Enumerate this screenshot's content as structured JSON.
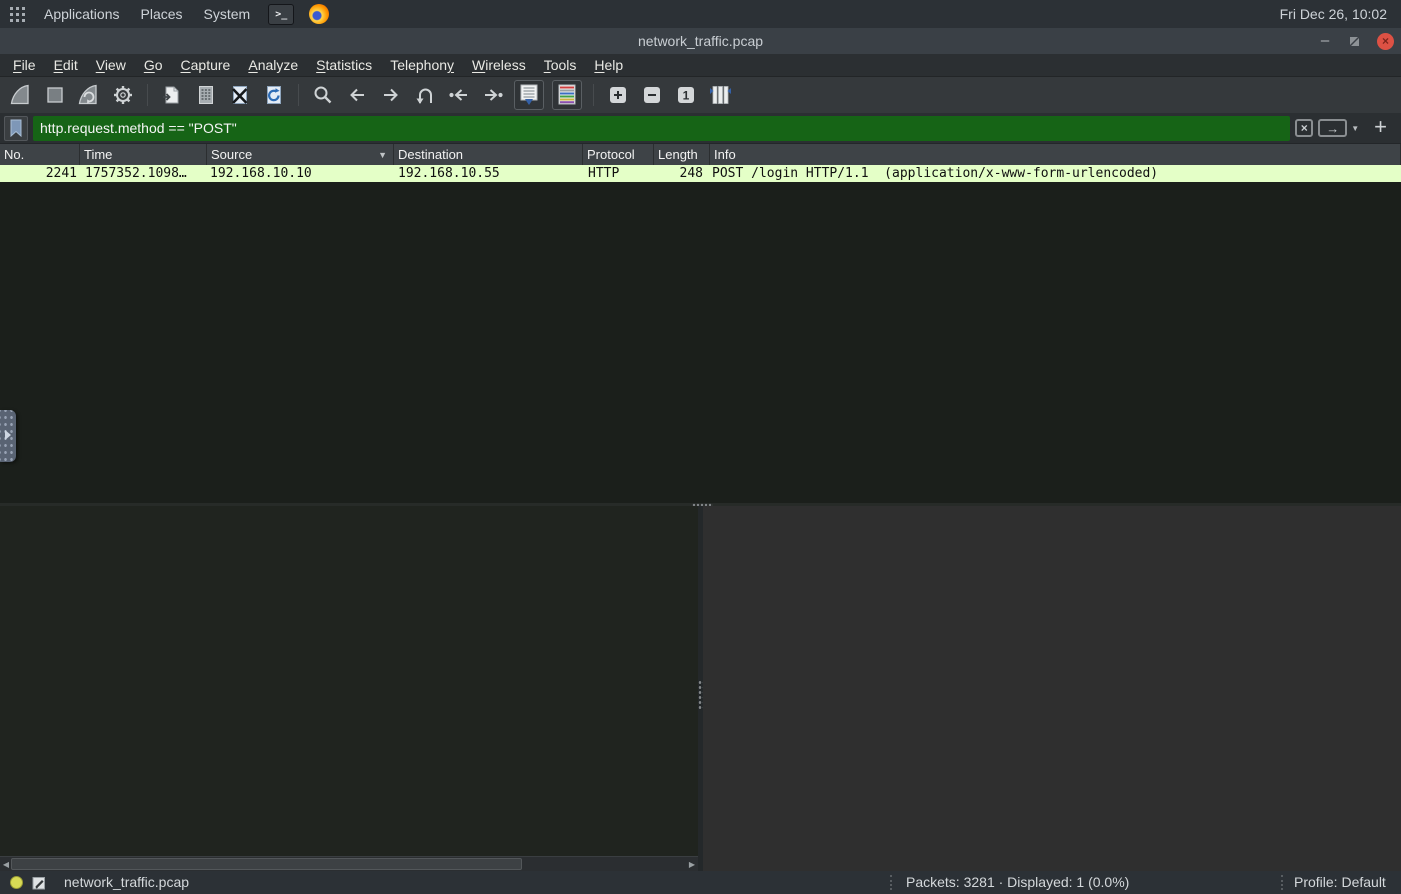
{
  "desktop_bar": {
    "applications": "Applications",
    "places": "Places",
    "system": "System",
    "clock": "Fri Dec 26, 10:02"
  },
  "window": {
    "title": "network_traffic.pcap"
  },
  "menu_bar": {
    "items": [
      {
        "label": "File",
        "mnemonic_index": 0
      },
      {
        "label": "Edit",
        "mnemonic_index": 0
      },
      {
        "label": "View",
        "mnemonic_index": 0
      },
      {
        "label": "Go",
        "mnemonic_index": 0
      },
      {
        "label": "Capture",
        "mnemonic_index": 0
      },
      {
        "label": "Analyze",
        "mnemonic_index": 0
      },
      {
        "label": "Statistics",
        "mnemonic_index": 0
      },
      {
        "label": "Telephony",
        "mnemonic_index": 8
      },
      {
        "label": "Wireless",
        "mnemonic_index": 0
      },
      {
        "label": "Tools",
        "mnemonic_index": 0
      },
      {
        "label": "Help",
        "mnemonic_index": 0
      }
    ]
  },
  "toolbar": {
    "buttons": [
      "start-capture",
      "stop-capture",
      "restart-capture",
      "capture-options",
      "open-file",
      "save-file",
      "close-file",
      "reload-file",
      "find-packet",
      "go-back",
      "go-forward",
      "go-to-packet",
      "go-first-packet",
      "go-last-packet",
      "auto-scroll-toggle",
      "colorize-toggle",
      "zoom-in",
      "zoom-out",
      "normal-size",
      "resize-columns"
    ]
  },
  "filter_bar": {
    "value": "http.request.method == \"POST\"",
    "valid_background": "#166416"
  },
  "packet_list": {
    "columns": [
      "No.",
      "Time",
      "Source",
      "Destination",
      "Protocol",
      "Length",
      "Info"
    ],
    "sort": {
      "column": "Source",
      "direction": "descending"
    },
    "row_highlight_color": "#e4ffc7",
    "rows": [
      {
        "no": "2241",
        "time": "1757352.1098…",
        "source": "192.168.10.10",
        "destination": "192.168.10.55",
        "protocol": "HTTP",
        "length": "248",
        "info": "POST /login HTTP/1.1  (application/x-www-form-urlencoded)"
      }
    ]
  },
  "status_bar": {
    "file_name": "network_traffic.pcap",
    "packets_summary": "Packets: 3281 · Displayed: 1 (0.0%)",
    "profile": "Profile: Default"
  },
  "icons": {
    "minimize": "–",
    "close": "×",
    "clear_filter": "×",
    "apply_filter": "→",
    "dropdown_chevron": "▼",
    "add_filter": "+",
    "sort_indicator": "▼",
    "terminal_prompt": ">_",
    "scroll_left": "◀",
    "scroll_right": "▶"
  }
}
